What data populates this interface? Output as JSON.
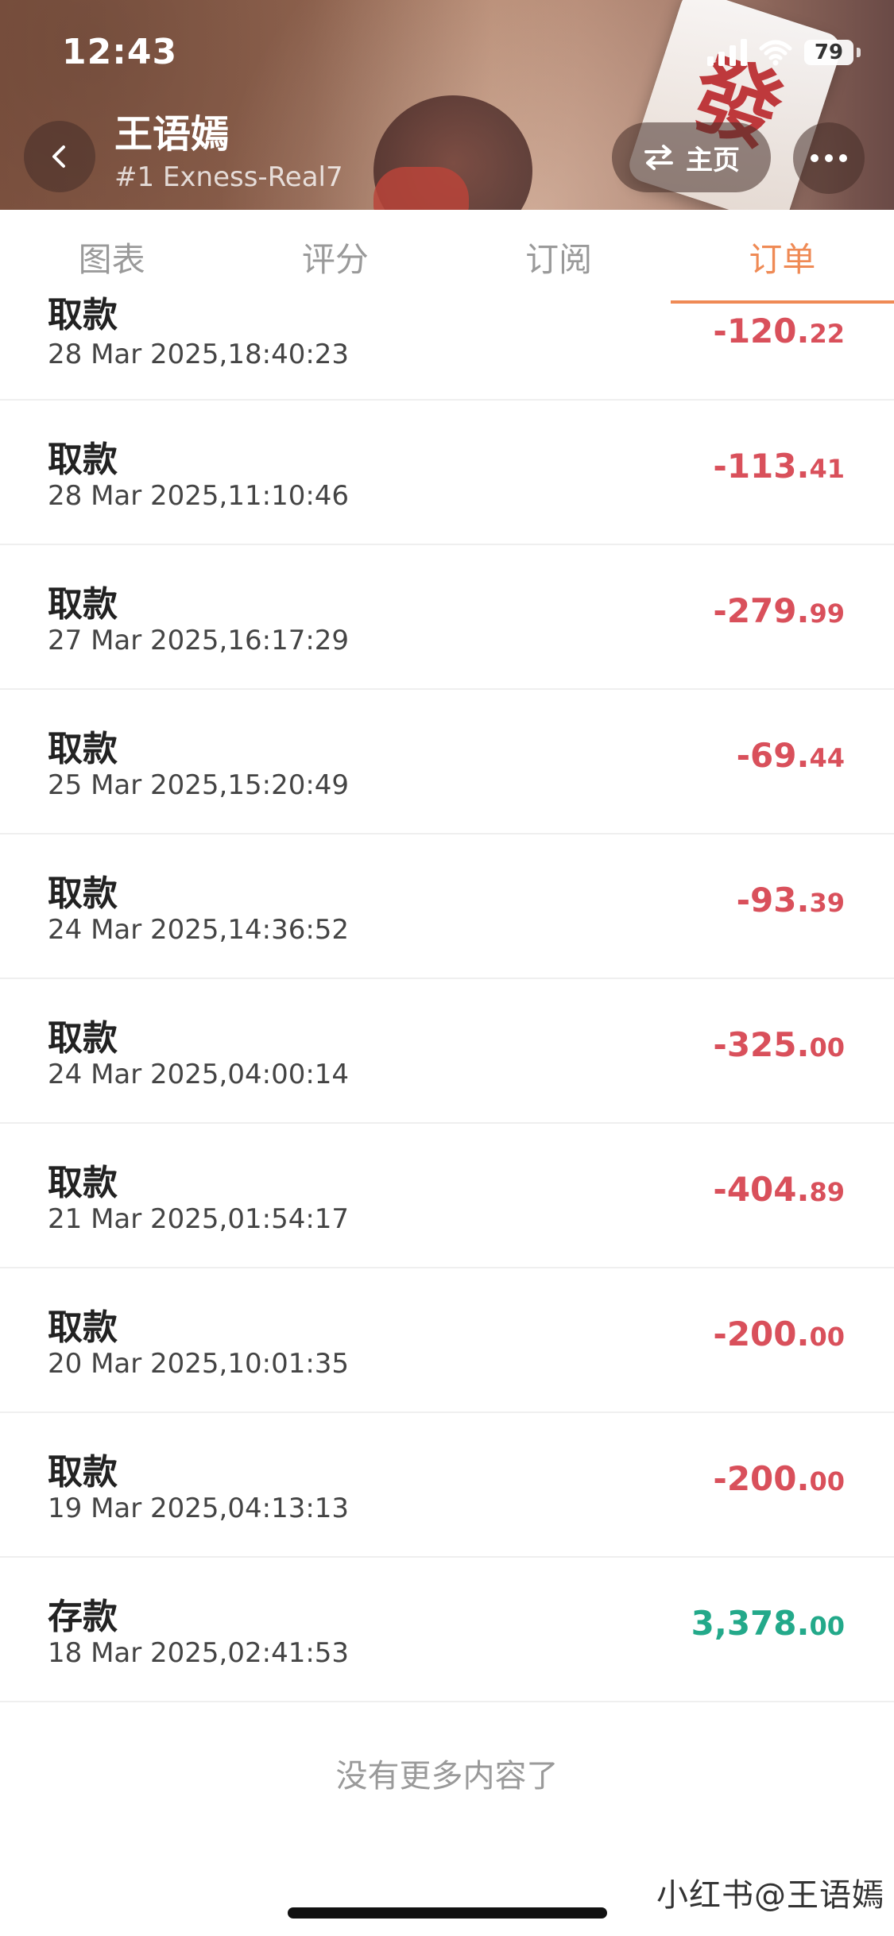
{
  "status_bar": {
    "time": "12:43",
    "battery": "79"
  },
  "header": {
    "title": "王语嫣",
    "subtitle": "#1 Exness-Real7",
    "home_button_label": "主页"
  },
  "tabs": [
    {
      "label": "图表",
      "active": false
    },
    {
      "label": "评分",
      "active": false
    },
    {
      "label": "订阅",
      "active": false
    },
    {
      "label": "订单",
      "active": true
    }
  ],
  "transactions": [
    {
      "type": "取款",
      "datetime": "28 Mar 2025,18:40:23",
      "amount_main": "-120.",
      "amount_dec": "22",
      "direction": "negative"
    },
    {
      "type": "取款",
      "datetime": "28 Mar 2025,11:10:46",
      "amount_main": "-113.",
      "amount_dec": "41",
      "direction": "negative"
    },
    {
      "type": "取款",
      "datetime": "27 Mar 2025,16:17:29",
      "amount_main": "-279.",
      "amount_dec": "99",
      "direction": "negative"
    },
    {
      "type": "取款",
      "datetime": "25 Mar 2025,15:20:49",
      "amount_main": "-69.",
      "amount_dec": "44",
      "direction": "negative"
    },
    {
      "type": "取款",
      "datetime": "24 Mar 2025,14:36:52",
      "amount_main": "-93.",
      "amount_dec": "39",
      "direction": "negative"
    },
    {
      "type": "取款",
      "datetime": "24 Mar 2025,04:00:14",
      "amount_main": "-325.",
      "amount_dec": "00",
      "direction": "negative"
    },
    {
      "type": "取款",
      "datetime": "21 Mar 2025,01:54:17",
      "amount_main": "-404.",
      "amount_dec": "89",
      "direction": "negative"
    },
    {
      "type": "取款",
      "datetime": "20 Mar 2025,10:01:35",
      "amount_main": "-200.",
      "amount_dec": "00",
      "direction": "negative"
    },
    {
      "type": "取款",
      "datetime": "19 Mar 2025,04:13:13",
      "amount_main": "-200.",
      "amount_dec": "00",
      "direction": "negative"
    },
    {
      "type": "存款",
      "datetime": "18 Mar 2025,02:41:53",
      "amount_main": "3,378.",
      "amount_dec": "00",
      "direction": "positive"
    }
  ],
  "footer": {
    "no_more_text": "没有更多内容了"
  },
  "watermark": "小红书@王语嫣",
  "colors": {
    "accent": "#ef8a55",
    "negative": "#d9505b",
    "positive": "#23a98a"
  }
}
